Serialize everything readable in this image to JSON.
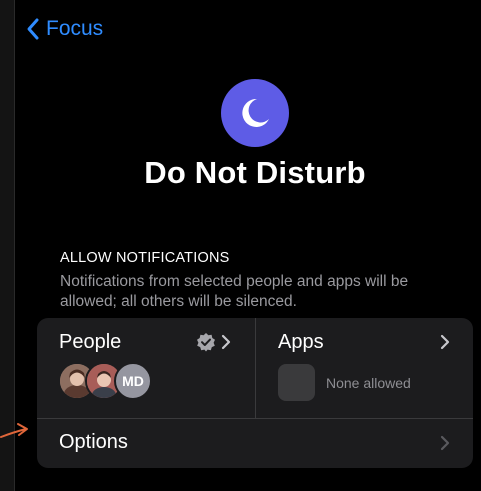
{
  "nav": {
    "back_label": "Focus"
  },
  "header": {
    "title": "Do Not Disturb",
    "icon": "moon-icon",
    "icon_color": "#5e5ce6"
  },
  "allow_section": {
    "header": "ALLOW NOTIFICATIONS",
    "description": "Notifications from selected people and apps will be allowed; all others will be silenced."
  },
  "people": {
    "label": "People",
    "avatars": [
      {
        "type": "photo"
      },
      {
        "type": "photo"
      },
      {
        "type": "initials",
        "initials": "MD"
      }
    ]
  },
  "apps": {
    "label": "Apps",
    "status": "None allowed"
  },
  "options": {
    "label": "Options"
  },
  "colors": {
    "accent": "#2f8cff",
    "card": "#1c1c1e",
    "annotation_arrow": "#e0663a"
  }
}
